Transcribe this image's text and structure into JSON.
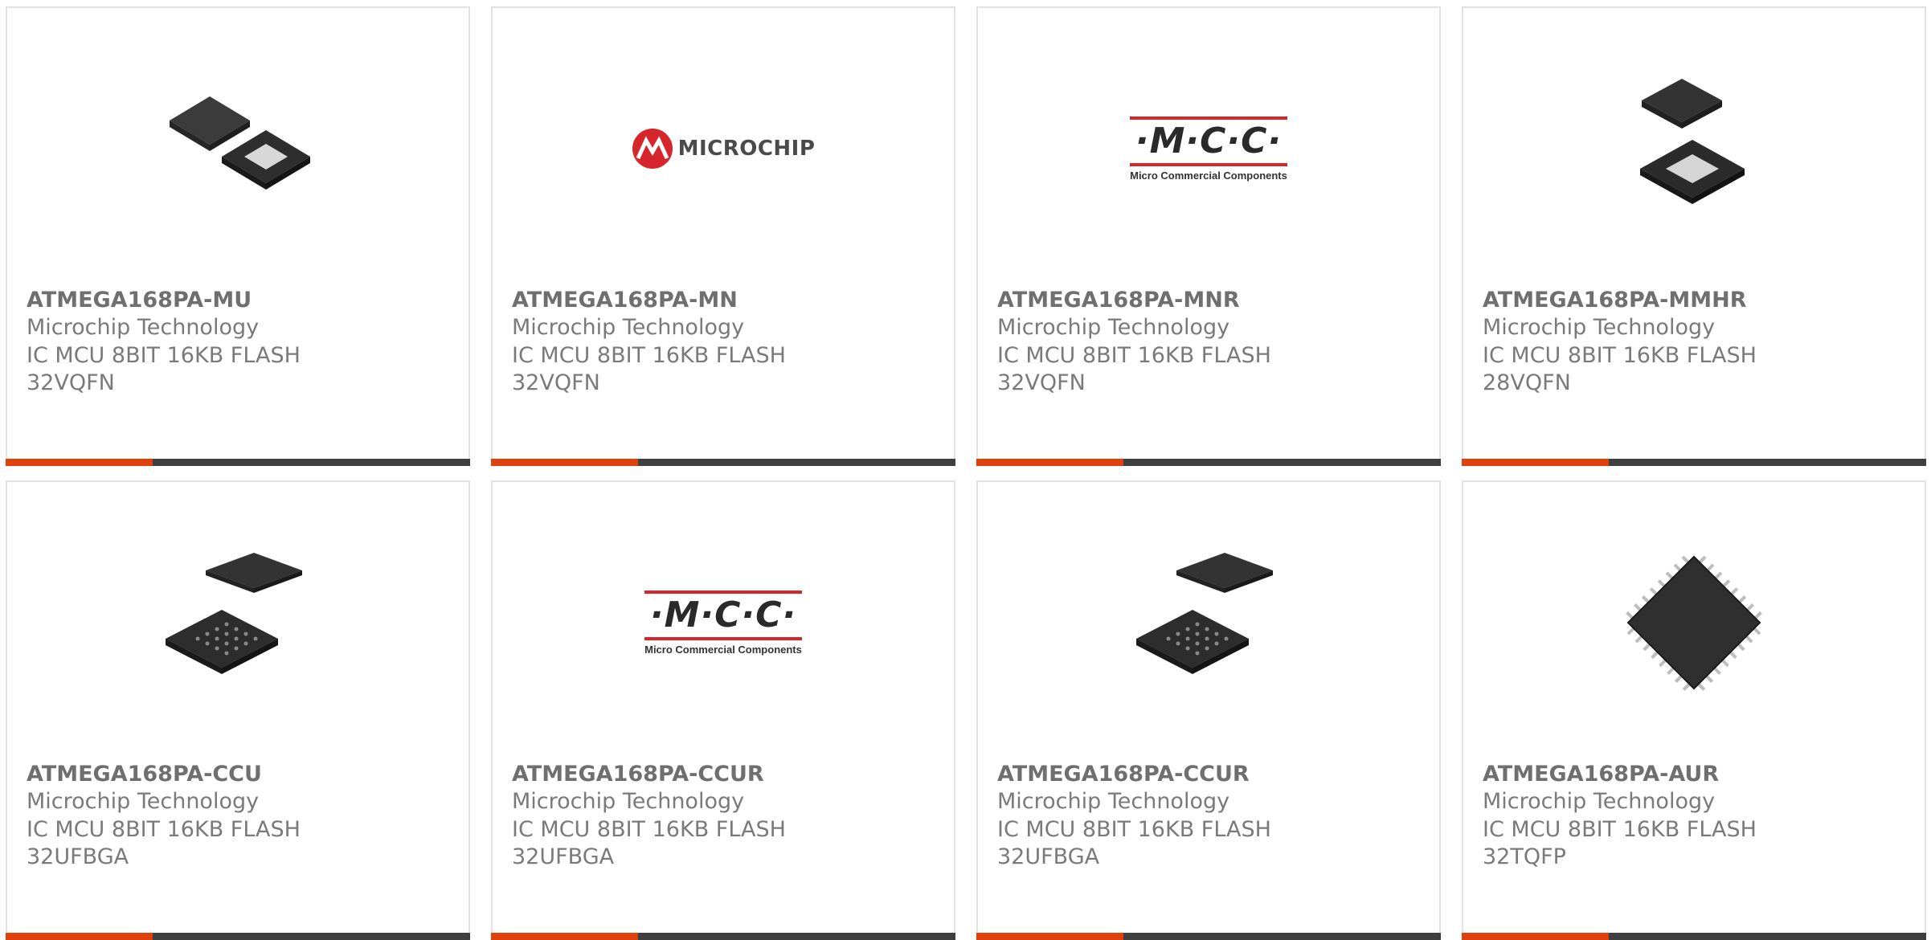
{
  "products": [
    {
      "part": "ATMEGA168PA-MU",
      "maker": "Microchip Technology",
      "desc": "IC MCU 8BIT 16KB FLASH 32VQFN",
      "image": "qfn-32-chip-icon"
    },
    {
      "part": "ATMEGA168PA-MN",
      "maker": "Microchip Technology",
      "desc": "IC MCU 8BIT 16KB FLASH 32VQFN",
      "image": "microchip-logo"
    },
    {
      "part": "ATMEGA168PA-MNR",
      "maker": "Microchip Technology",
      "desc": "IC MCU 8BIT 16KB FLASH 32VQFN",
      "image": "mcc-logo"
    },
    {
      "part": "ATMEGA168PA-MMHR",
      "maker": "Microchip Technology",
      "desc": "IC MCU 8BIT 16KB FLASH 28VQFN",
      "image": "qfn-28-chip-icon"
    },
    {
      "part": "ATMEGA168PA-CCU",
      "maker": "Microchip Technology",
      "desc": "IC MCU 8BIT 16KB FLASH 32UFBGA",
      "image": "bga-chip-icon"
    },
    {
      "part": "ATMEGA168PA-CCUR",
      "maker": "Microchip Technology",
      "desc": "IC MCU 8BIT 16KB FLASH 32UFBGA",
      "image": "mcc-logo"
    },
    {
      "part": "ATMEGA168PA-CCUR",
      "maker": "Microchip Technology",
      "desc": "IC MCU 8BIT 16KB FLASH 32UFBGA",
      "image": "bga-chip-icon"
    },
    {
      "part": "ATMEGA168PA-AUR",
      "maker": "Microchip Technology",
      "desc": "IC MCU 8BIT 16KB FLASH 32TQFP",
      "image": "tqfp-chip-icon"
    }
  ],
  "logos": {
    "microchip_text": "MICROCHIP",
    "mcc_text": "·M·C·C·",
    "mcc_subtext": "Micro Commercial Components"
  },
  "colors": {
    "accent": "#e0400c",
    "bar": "#3f3f3f",
    "border": "#e2e2e2",
    "title_text": "#6f6f6f",
    "body_text": "#7a7a7a"
  }
}
